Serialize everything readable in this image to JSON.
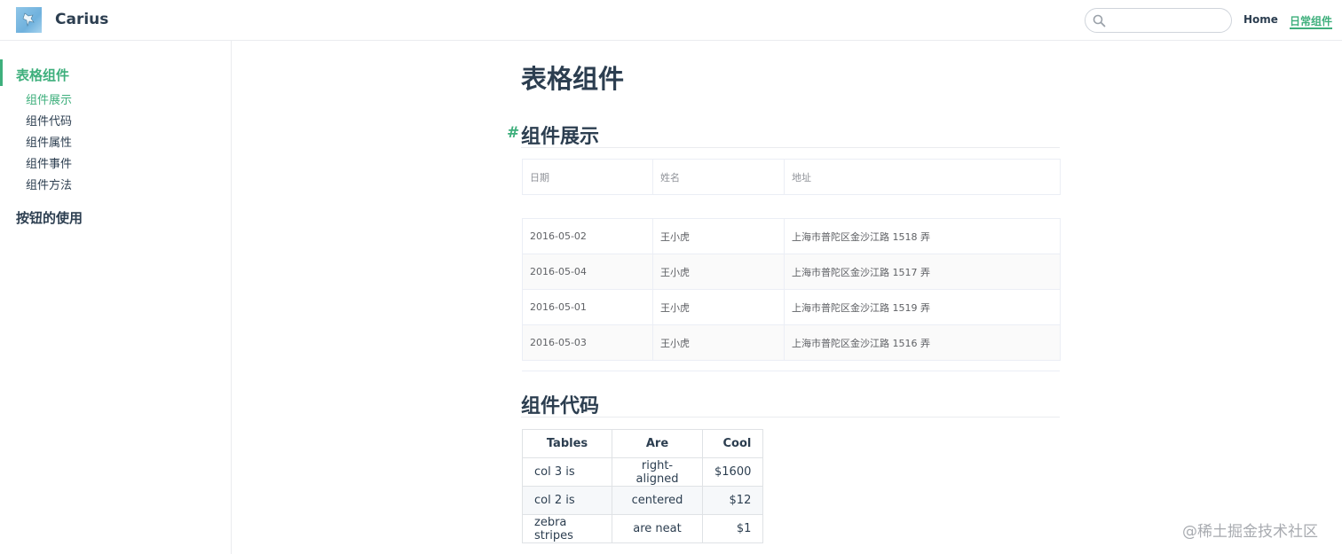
{
  "navbar": {
    "site_name": "Carius",
    "search_placeholder": "",
    "links": [
      "Home",
      "日常组件"
    ]
  },
  "sidebar": {
    "groups": [
      {
        "title": "表格组件",
        "items": [
          "组件展示",
          "组件代码",
          "组件属性",
          "组件事件",
          "组件方法"
        ]
      },
      {
        "title": "按钮的使用",
        "items": []
      }
    ]
  },
  "main": {
    "title": "表格组件",
    "anchor": "#",
    "section1_title": "组件展示",
    "section2_title": "组件代码",
    "el_table": {
      "headers": [
        "日期",
        "姓名",
        "地址"
      ],
      "rows": [
        [
          "2016-05-02",
          "王小虎",
          "上海市普陀区金沙江路 1518 弄"
        ],
        [
          "2016-05-04",
          "王小虎",
          "上海市普陀区金沙江路 1517 弄"
        ],
        [
          "2016-05-01",
          "王小虎",
          "上海市普陀区金沙江路 1519 弄"
        ],
        [
          "2016-05-03",
          "王小虎",
          "上海市普陀区金沙江路 1516 弄"
        ]
      ]
    },
    "md_table": {
      "headers": [
        "Tables",
        "Are",
        "Cool"
      ],
      "rows": [
        [
          "col 3 is",
          "right-aligned",
          "$1600"
        ],
        [
          "col 2 is",
          "centered",
          "$12"
        ],
        [
          "zebra stripes",
          "are neat",
          "$1"
        ]
      ]
    }
  },
  "watermark": "@稀土掘金技术社区",
  "colors": {
    "accent": "#3eaf7c",
    "text": "#2c3e50",
    "table_text": "#606266"
  }
}
